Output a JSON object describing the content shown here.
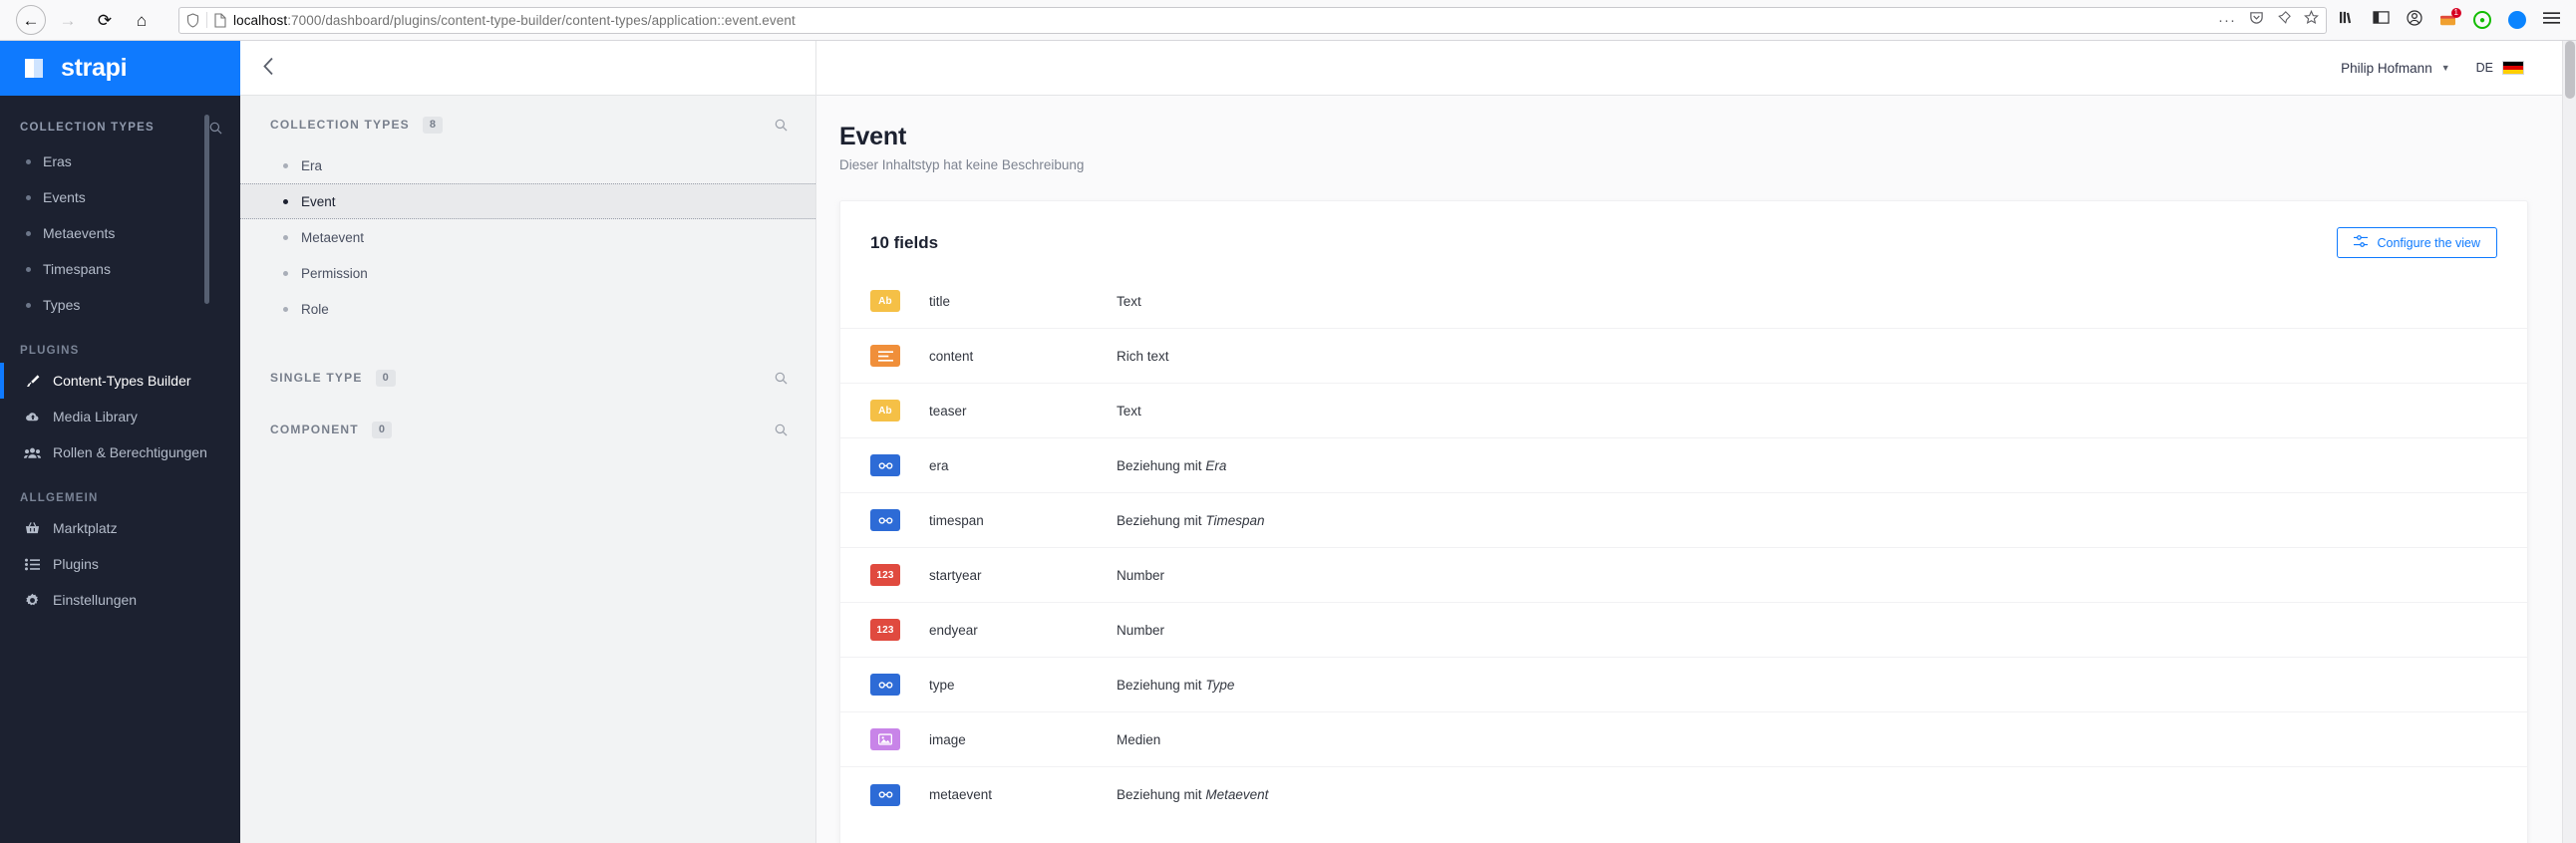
{
  "browser": {
    "back_icon": "back-arrow-icon",
    "forward_icon": "forward-arrow-icon",
    "reload_icon": "reload-icon",
    "home_icon": "home-icon",
    "url_host": "localhost",
    "url_path": ":7000/dashboard/plugins/content-type-builder/content-types/application::event.event",
    "shield_icon": "tracking-protection-shield-icon",
    "page_icon": "page-document-icon",
    "more_icon": "ellipsis-icon",
    "pocket_icon": "pocket-icon",
    "pin_icon": "pin-tab-icon",
    "bookmark_icon": "star-bookmark-icon",
    "library_icon": "library-icon",
    "sidebar_icon": "sidebar-toggle-icon",
    "account_icon": "account-circle-icon",
    "extension_badge": "1",
    "menu_icon": "hamburger-menu-icon"
  },
  "sidebar": {
    "brand": "strapi",
    "brand_color": "#0f7afe",
    "collection_types_label": "COLLECTION TYPES",
    "collection_search_icon": "search-icon",
    "collection_items": [
      {
        "label": "Eras"
      },
      {
        "label": "Events"
      },
      {
        "label": "Metaevents"
      },
      {
        "label": "Timespans"
      },
      {
        "label": "Types"
      }
    ],
    "plugins_label": "PLUGINS",
    "plugin_items": [
      {
        "label": "Content-Types Builder",
        "icon": "brush-icon",
        "active": true
      },
      {
        "label": "Media Library",
        "icon": "cloud-upload-icon",
        "active": false
      },
      {
        "label": "Rollen & Berechtigungen",
        "icon": "users-icon",
        "active": false
      }
    ],
    "general_label": "ALLGEMEIN",
    "general_items": [
      {
        "label": "Marktplatz",
        "icon": "shopping-basket-icon"
      },
      {
        "label": "Plugins",
        "icon": "list-icon"
      },
      {
        "label": "Einstellungen",
        "icon": "gear-icon"
      }
    ]
  },
  "ct_panel": {
    "back_icon": "chevron-left-icon",
    "sections": [
      {
        "title": "COLLECTION TYPES",
        "count": "8",
        "search_icon": "search-icon",
        "items": [
          {
            "label": "Era",
            "selected": false
          },
          {
            "label": "Event",
            "selected": true
          },
          {
            "label": "Metaevent",
            "selected": false
          },
          {
            "label": "Permission",
            "selected": false
          },
          {
            "label": "Role",
            "selected": false
          }
        ]
      },
      {
        "title": "SINGLE TYPE",
        "count": "0",
        "search_icon": "search-icon",
        "items": []
      },
      {
        "title": "COMPONENT",
        "count": "0",
        "search_icon": "search-icon",
        "items": []
      }
    ]
  },
  "topbar": {
    "user_name": "Philip Hofmann",
    "caret_icon": "chevron-down-icon",
    "language": "DE",
    "flag_icon": "german-flag-icon"
  },
  "main": {
    "title": "Event",
    "subtitle": "Dieser Inhaltstyp hat keine Beschreibung",
    "fields_count_label": "10 fields",
    "configure_label": "Configure the view",
    "configure_icon": "sliders-icon",
    "accent_color": "#0f7afe",
    "fields": [
      {
        "name": "title",
        "type_label": "Text",
        "relation": "",
        "badge": "Ab",
        "badge_kind": "ico-text",
        "icon": "text-field-icon"
      },
      {
        "name": "content",
        "type_label": "Rich text",
        "relation": "",
        "badge": "≡",
        "badge_kind": "ico-rich",
        "icon": "rich-text-icon"
      },
      {
        "name": "teaser",
        "type_label": "Text",
        "relation": "",
        "badge": "Ab",
        "badge_kind": "ico-text",
        "icon": "text-field-icon"
      },
      {
        "name": "era",
        "type_label": "Beziehung mit",
        "relation": "Era",
        "badge": "⚯",
        "badge_kind": "ico-rel",
        "icon": "relation-icon"
      },
      {
        "name": "timespan",
        "type_label": "Beziehung mit",
        "relation": "Timespan",
        "badge": "⚯",
        "badge_kind": "ico-rel",
        "icon": "relation-icon"
      },
      {
        "name": "startyear",
        "type_label": "Number",
        "relation": "",
        "badge": "123",
        "badge_kind": "ico-num",
        "icon": "number-field-icon"
      },
      {
        "name": "endyear",
        "type_label": "Number",
        "relation": "",
        "badge": "123",
        "badge_kind": "ico-num",
        "icon": "number-field-icon"
      },
      {
        "name": "type",
        "type_label": "Beziehung mit",
        "relation": "Type",
        "badge": "⚯",
        "badge_kind": "ico-rel",
        "icon": "relation-icon"
      },
      {
        "name": "image",
        "type_label": "Medien",
        "relation": "",
        "badge": "▣",
        "badge_kind": "ico-media",
        "icon": "media-icon"
      },
      {
        "name": "metaevent",
        "type_label": "Beziehung mit",
        "relation": "Metaevent",
        "badge": "⚯",
        "badge_kind": "ico-rel",
        "icon": "relation-icon"
      }
    ]
  }
}
